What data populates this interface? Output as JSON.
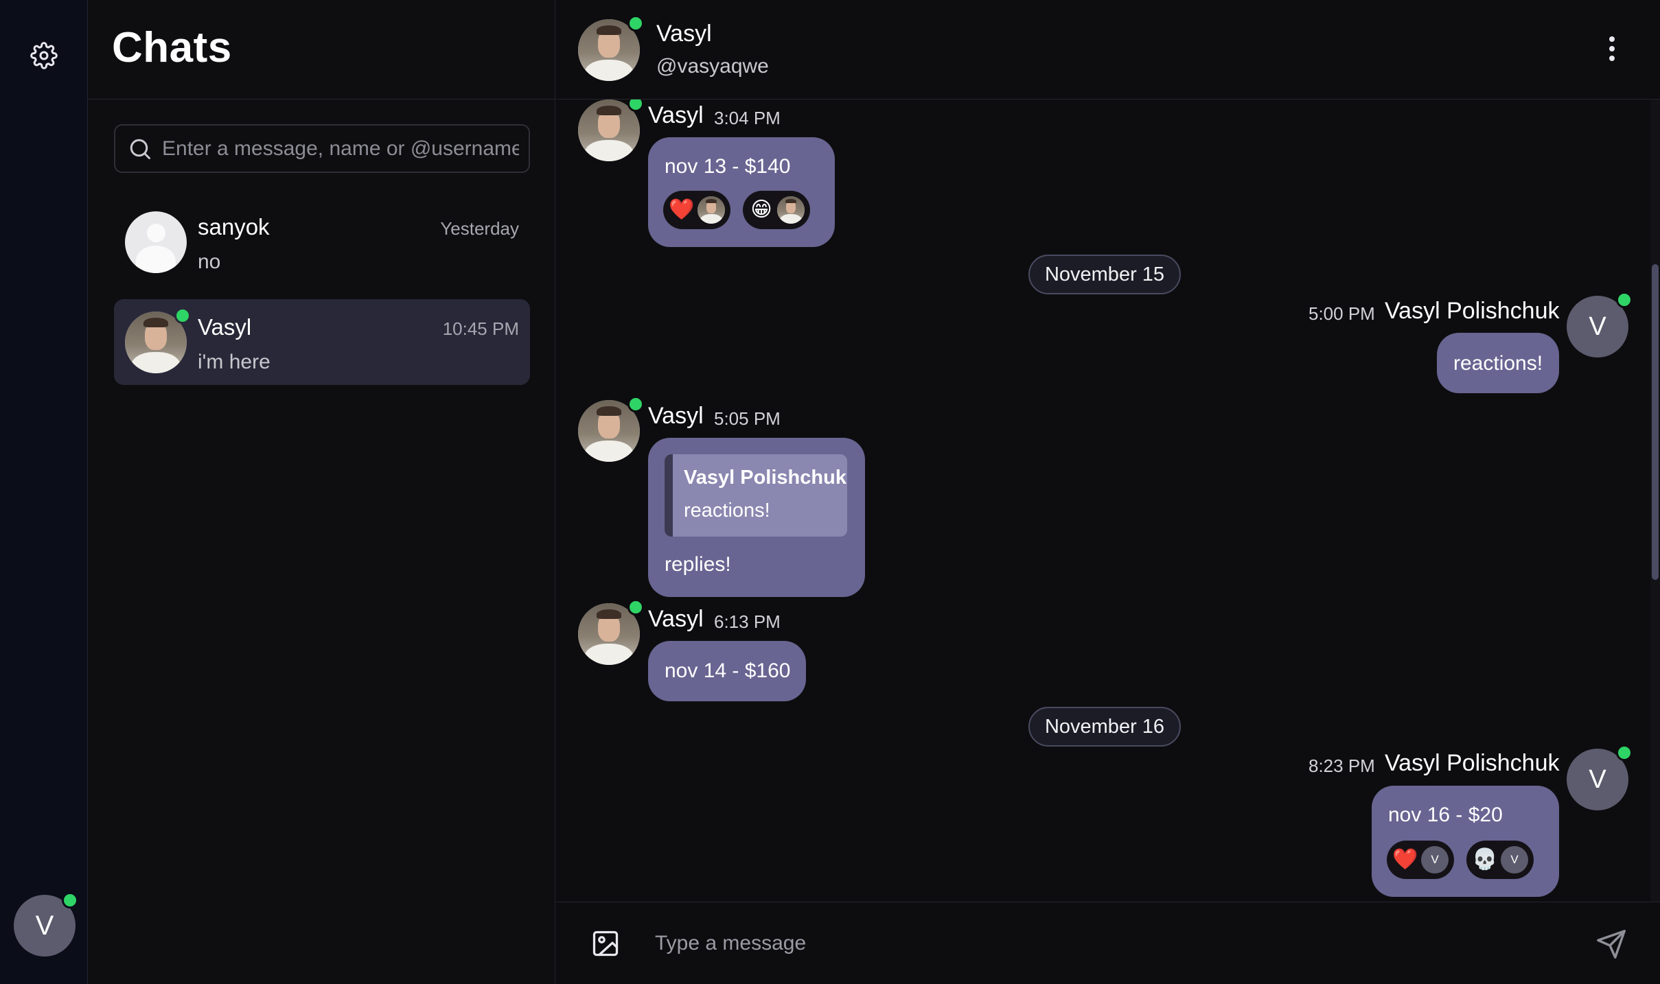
{
  "sidebar": {
    "settings_icon": "gear-icon",
    "current_user_initial": "V"
  },
  "chat_list": {
    "title": "Chats",
    "search_placeholder": "Enter a message, name or @username",
    "conversations": [
      {
        "name": "sanyok",
        "time": "Yesterday",
        "preview": "no",
        "active": false,
        "online": false
      },
      {
        "name": "Vasyl",
        "time": "10:45 PM",
        "preview": "i'm here",
        "active": true,
        "online": true
      }
    ]
  },
  "chat_header": {
    "name": "Vasyl",
    "username": "@vasyaqwe",
    "menu_icon": "kebab-menu-icon"
  },
  "messages": [
    {
      "sender": "Vasyl",
      "time": "3:04 PM",
      "text": "nov 13 - $140",
      "reactions": [
        {
          "emoji": "❤️"
        },
        {
          "emoji": "😁"
        }
      ]
    },
    {
      "type": "date",
      "label": "November 15"
    },
    {
      "sender": "Vasyl Polishchuk",
      "time": "5:00 PM",
      "text": "reactions!",
      "avatar_initial": "V"
    },
    {
      "sender": "Vasyl",
      "time": "5:05 PM",
      "reply_to": {
        "name": "Vasyl Polishchuk",
        "text": "reactions!"
      },
      "text": "replies!"
    },
    {
      "sender": "Vasyl",
      "time": "6:13 PM",
      "text": "nov 14 - $160"
    },
    {
      "type": "date",
      "label": "November 16"
    },
    {
      "sender": "Vasyl Polishchuk",
      "time": "8:23 PM",
      "text": "nov 16 - $20",
      "avatar_initial": "V",
      "reactions": [
        {
          "emoji": "❤️",
          "by": "V"
        },
        {
          "emoji": "💀",
          "by": "V"
        }
      ]
    }
  ],
  "composer": {
    "placeholder": "Type a message",
    "attach_icon": "image-icon",
    "send_icon": "send-icon"
  },
  "colors": {
    "online": "#2fd466",
    "bubble": "#686592",
    "active_chat": "#282838"
  }
}
